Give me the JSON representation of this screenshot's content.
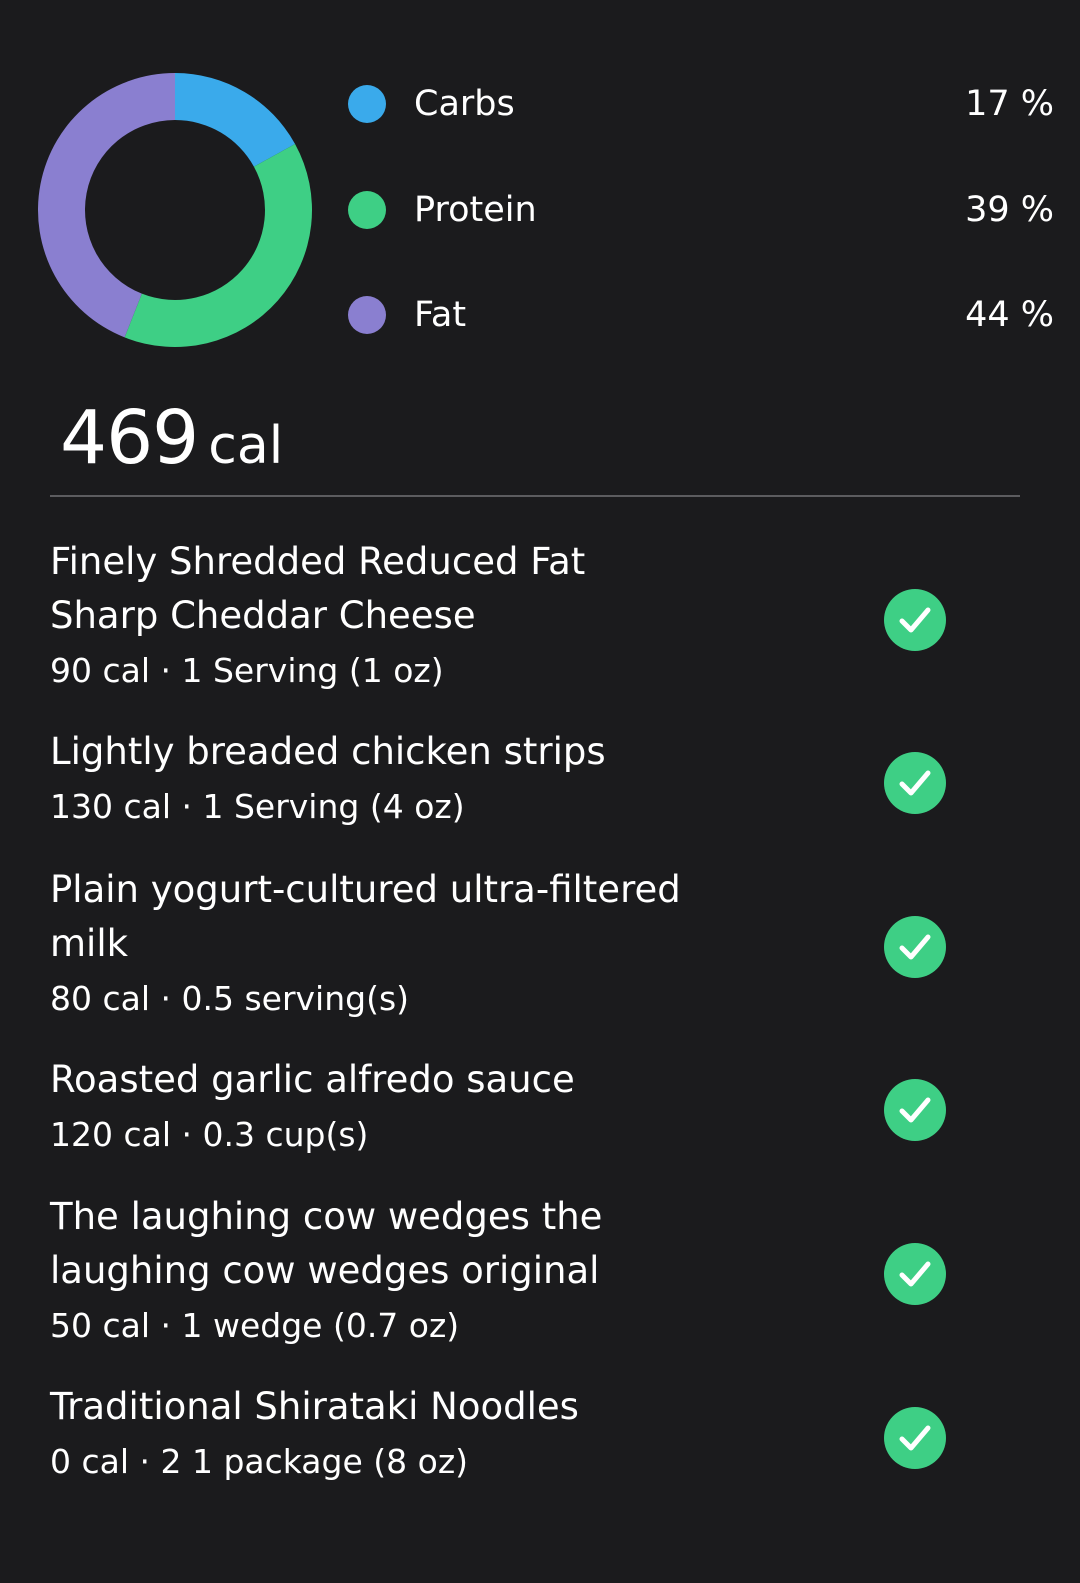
{
  "macros": [
    {
      "name": "Carbs",
      "percent": "17 %",
      "value": 17,
      "color": "#3aaaeb"
    },
    {
      "name": "Protein",
      "percent": "39 %",
      "value": 39,
      "color": "#3ecf85"
    },
    {
      "name": "Fat",
      "percent": "44 %",
      "value": 44,
      "color": "#8a7fd0"
    }
  ],
  "total": {
    "value": "469",
    "unit": "cal"
  },
  "foods": [
    {
      "name": "Finely Shredded Reduced Fat Sharp Cheddar Cheese",
      "detail": "90 cal · 1 Serving (1 oz)",
      "checked": true
    },
    {
      "name": "Lightly breaded chicken strips",
      "detail": "130 cal · 1 Serving (4 oz)",
      "checked": true
    },
    {
      "name": "Plain yogurt-cultured ultra-filtered milk",
      "detail": "80 cal · 0.5 serving(s)",
      "checked": true
    },
    {
      "name": "Roasted garlic alfredo sauce",
      "detail": "120 cal · 0.3 cup(s)",
      "checked": true
    },
    {
      "name": "The laughing cow wedges the laughing cow wedges original",
      "detail": "50 cal · 1 wedge (0.7 oz)",
      "checked": true
    },
    {
      "name": "Traditional Shirataki Noodles",
      "detail": "0 cal · 2 1 package  (8 oz)",
      "checked": true
    }
  ],
  "icons": {
    "checkmark": "check-circle-icon"
  }
}
